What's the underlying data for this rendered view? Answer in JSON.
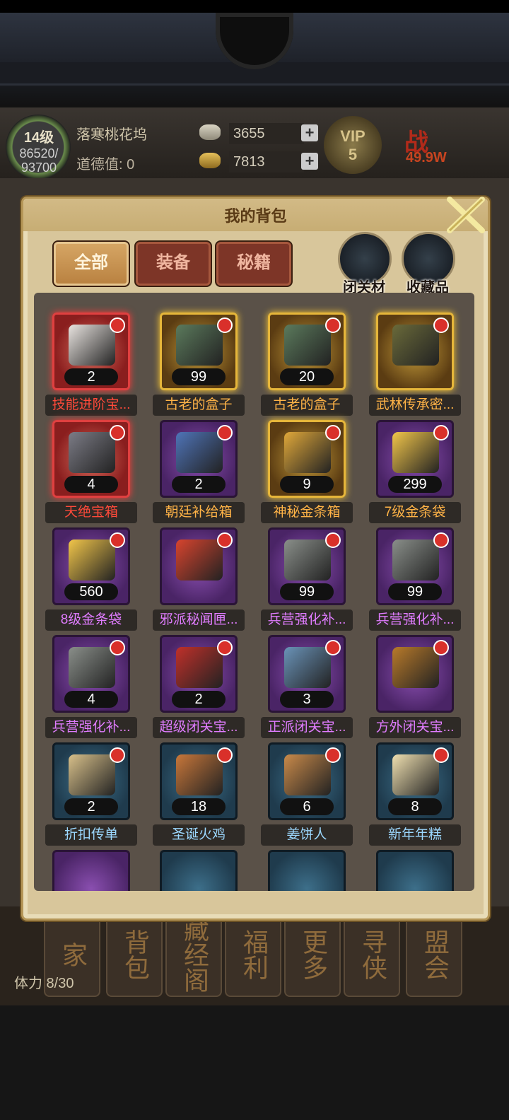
{
  "hud": {
    "level": "14级",
    "exp": "86520/\n93700",
    "location": "落寒桃花坞",
    "moral": "道德值:  0",
    "silver": "3655",
    "gold": "7813",
    "vip_label": "VIP",
    "vip_level": "5",
    "power": "战",
    "power_value": "49.9W"
  },
  "bottom_nav": {
    "items": [
      "家",
      "背包",
      "藏经阁",
      "福利",
      "更多",
      "寻侠",
      "盟会"
    ],
    "stamina": "体力 8/30"
  },
  "bag": {
    "title": "我的背包",
    "tabs": [
      "全部",
      "装备",
      "秘籍"
    ],
    "active_tab": "全部",
    "categories": [
      "闭关材料",
      "收藏品"
    ],
    "items": [
      {
        "name": "技能进阶宝...",
        "qty": "2",
        "frame": "red",
        "name_color": "red",
        "art_color": "#e9e4e0"
      },
      {
        "name": "古老的盒子",
        "qty": "99",
        "frame": "gold",
        "name_color": "orange",
        "art_color": "#5b7a5c"
      },
      {
        "name": "古老的盒子",
        "qty": "20",
        "frame": "gold",
        "name_color": "orange",
        "art_color": "#5b7a5c"
      },
      {
        "name": "武林传承密...",
        "qty": "",
        "frame": "gold",
        "name_color": "orange",
        "art_color": "#6a6a3a"
      },
      {
        "name": "天绝宝箱",
        "qty": "4",
        "frame": "red",
        "name_color": "red",
        "art_color": "#7c7c86"
      },
      {
        "name": "朝廷补给箱",
        "qty": "2",
        "frame": "purple",
        "name_color": "orange",
        "art_color": "#4f74b8"
      },
      {
        "name": "神秘金条箱",
        "qty": "9",
        "frame": "gold",
        "name_color": "orange",
        "art_color": "#e0a83a"
      },
      {
        "name": "7级金条袋",
        "qty": "299",
        "frame": "purple",
        "name_color": "orange",
        "art_color": "#f2c64a"
      },
      {
        "name": "8级金条袋",
        "qty": "560",
        "frame": "purple",
        "name_color": "purple",
        "art_color": "#f2c64a"
      },
      {
        "name": "邪派秘闻匣...",
        "qty": "",
        "frame": "purple",
        "name_color": "purple",
        "art_color": "#d8442e"
      },
      {
        "name": "兵营强化补...",
        "qty": "99",
        "frame": "purple",
        "name_color": "purple",
        "art_color": "#8a8f8a"
      },
      {
        "name": "兵营强化补...",
        "qty": "99",
        "frame": "purple",
        "name_color": "purple",
        "art_color": "#8a8f8a"
      },
      {
        "name": "兵营强化补...",
        "qty": "4",
        "frame": "purple",
        "name_color": "purple",
        "art_color": "#8a8f8a"
      },
      {
        "name": "超级闭关宝...",
        "qty": "2",
        "frame": "purple",
        "name_color": "purple",
        "art_color": "#c0302a"
      },
      {
        "name": "正派闭关宝...",
        "qty": "3",
        "frame": "purple",
        "name_color": "purple",
        "art_color": "#6a93b8"
      },
      {
        "name": "方外闭关宝...",
        "qty": "",
        "frame": "purple",
        "name_color": "purple",
        "art_color": "#b87a2a"
      },
      {
        "name": "折扣传单",
        "qty": "2",
        "frame": "blue",
        "name_color": "blue",
        "art_color": "#d8c08a"
      },
      {
        "name": "圣诞火鸡",
        "qty": "18",
        "frame": "blue",
        "name_color": "blue",
        "art_color": "#c8773a"
      },
      {
        "name": "姜饼人",
        "qty": "6",
        "frame": "blue",
        "name_color": "blue",
        "art_color": "#c98a4a"
      },
      {
        "name": "新年年糕",
        "qty": "8",
        "frame": "blue",
        "name_color": "blue",
        "art_color": "#f0e0b0"
      }
    ],
    "partial_row": [
      {
        "frame": "purple"
      },
      {
        "frame": "blue"
      },
      {
        "frame": "blue"
      },
      {
        "frame": "blue"
      }
    ]
  }
}
